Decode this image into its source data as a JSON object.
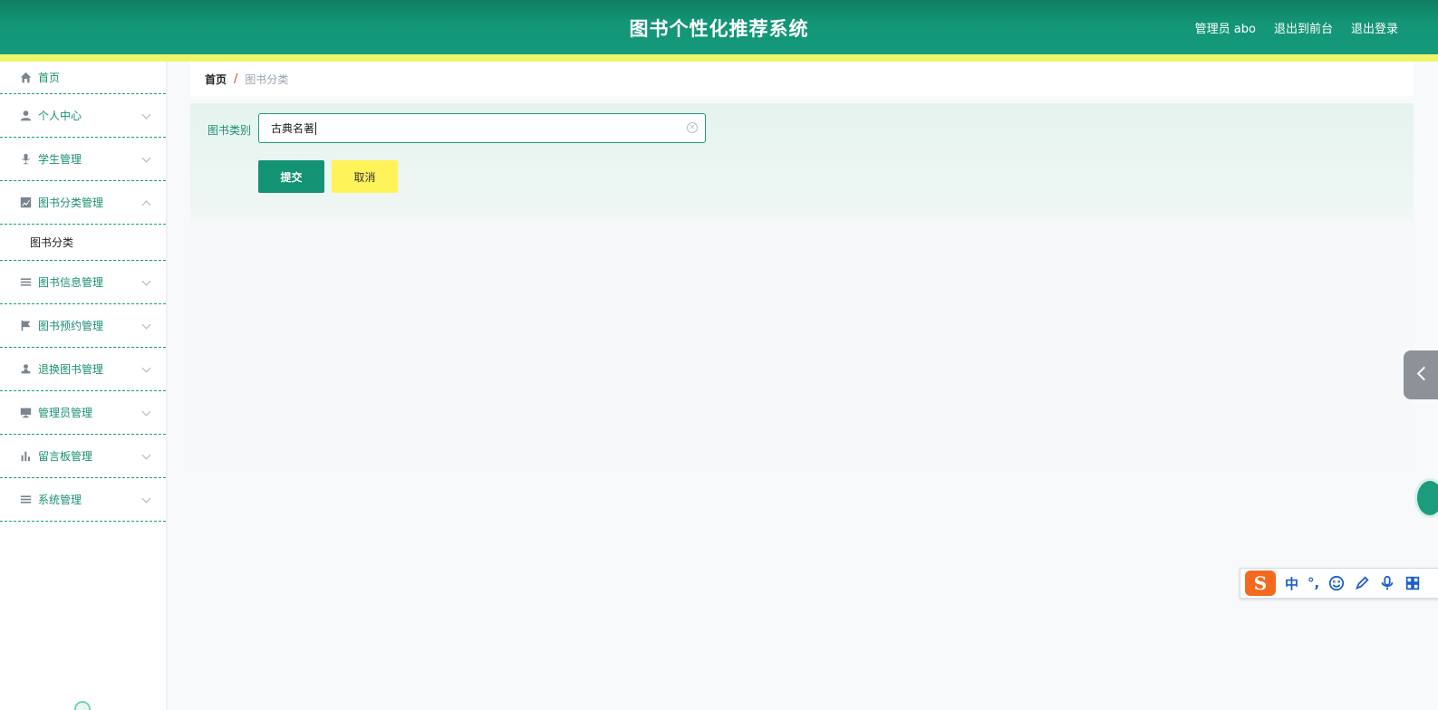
{
  "header": {
    "title": "图书个性化推荐系统",
    "user_label": "管理员 abo",
    "to_front": "退出到前台",
    "logout": "退出登录"
  },
  "sidebar": {
    "items": [
      {
        "label": "首页",
        "icon": "home-icon"
      },
      {
        "label": "个人中心",
        "icon": "user-icon"
      },
      {
        "label": "学生管理",
        "icon": "microphone-icon"
      },
      {
        "label": "图书分类管理",
        "icon": "chart-icon",
        "expanded": true,
        "children": [
          "图书分类"
        ]
      },
      {
        "label": "图书信息管理",
        "icon": "list-icon"
      },
      {
        "label": "图书预约管理",
        "icon": "flag-icon"
      },
      {
        "label": "退换图书管理",
        "icon": "user-stamp-icon"
      },
      {
        "label": "管理员管理",
        "icon": "monitor-icon"
      },
      {
        "label": "留言板管理",
        "icon": "bar-chart-icon"
      },
      {
        "label": "系统管理",
        "icon": "menu-icon"
      }
    ]
  },
  "breadcrumb": {
    "home": "首页",
    "separator": "/",
    "current": "图书分类"
  },
  "form": {
    "category_label": "图书类别",
    "category_value": "古典名著",
    "submit": "提交",
    "cancel": "取消"
  },
  "ime": {
    "logo": "S",
    "lang": "中",
    "punct": "°,"
  },
  "colors": {
    "primary": "#139274",
    "accent_yellow": "#fff35a",
    "header_stripe": "#eef56a"
  }
}
